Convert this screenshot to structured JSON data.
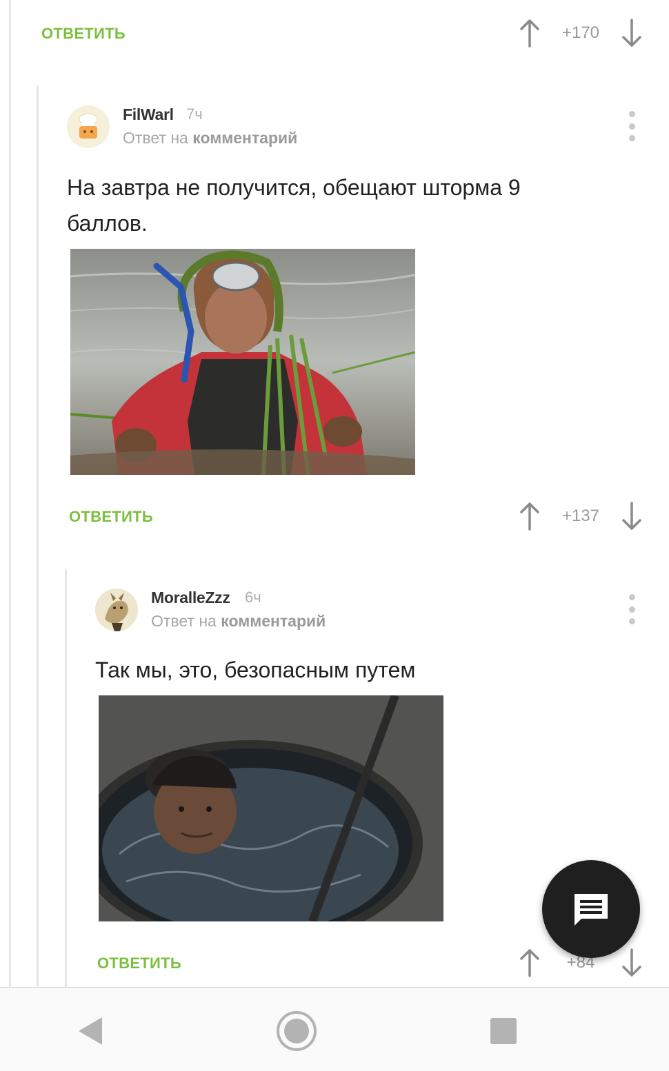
{
  "top_actions": {
    "reply_label": "ОТВЕТИТЬ",
    "score": "+170"
  },
  "comments": [
    {
      "author": "FilWarl",
      "time": "7ч",
      "reply_prefix": "Ответ на",
      "reply_link": "комментарий",
      "text_lines": [
        "На завтра не получится, обещают шторма 9",
        "баллов."
      ],
      "image": "photo-muddy-snorkeler-in-water",
      "reply_label": "ОТВЕТИТЬ",
      "score": "+137"
    },
    {
      "author": "MoralleZzz",
      "time": "6ч",
      "reply_prefix": "Ответ на",
      "reply_link": "комментарий",
      "text_lines": [
        "Так мы, это, безопасным путем"
      ],
      "image": "photo-man-in-flooded-manhole",
      "reply_label": "ОТВЕТИТЬ",
      "score": "+84"
    }
  ],
  "fab": {
    "icon": "comment-icon"
  },
  "navbar": {
    "icons": [
      "back-icon",
      "home-icon",
      "recents-icon"
    ]
  },
  "colors": {
    "accent_green": "#7cbf3f",
    "muted_gray": "#9a9a9a",
    "fab_bg": "#1f1f1f"
  }
}
